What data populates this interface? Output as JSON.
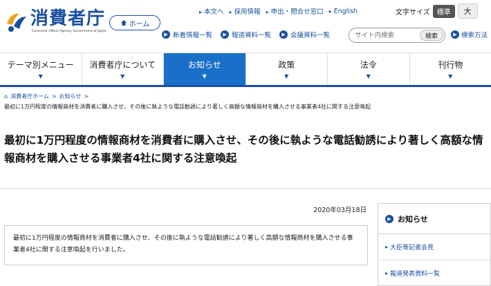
{
  "brand": {
    "name": "消費者庁",
    "subtitle": "Consumer Affairs Agency, Government of Japan",
    "colors": {
      "primary": "#1a4fa0",
      "active_nav": "#1a6fc9"
    }
  },
  "header": {
    "home_label": "ホーム",
    "top_links": [
      "本文へ",
      "採用情報",
      "申出・問合せ窓口",
      "English"
    ],
    "font_size_label": "文字サイズ",
    "font_size_standard": "標準",
    "font_size_large": "大",
    "sub_links": [
      "新着情報一覧",
      "報道資料一覧",
      "会議資料一覧"
    ],
    "search_placeholder": "サイト内検索",
    "search_button": "検索",
    "search_help": "検索方法"
  },
  "nav": {
    "items": [
      "テーマ別メニュー",
      "消費者庁について",
      "お知らせ",
      "政策",
      "法令",
      "刊行物"
    ],
    "active": "お知らせ"
  },
  "breadcrumb": {
    "items": [
      "消費者庁ホーム",
      "お知らせ"
    ],
    "separator": ">",
    "current": "最初に1万円程度の情報商材を消費者に購入させ、その後に執ような電話勧誘により著しく高額な情報商材を購入させる事業者4社に関する注意喚起"
  },
  "article": {
    "title": "最初に1万円程度の情報商材を消費者に購入させ、その後に執ような電話勧誘により著しく高額な情報商材を購入させる事業者4社に関する注意喚起",
    "date": "2020年03月18日",
    "summary": "最初に1万円程度の情報商材を消費者に購入させ、その後に執ような電話勧誘により著しく高額な情報商材を購入させる事業者4社に関する注意喚起を行いました。"
  },
  "sidebar": {
    "heading": "お知らせ",
    "items": [
      "大臣等記者会見",
      "報道発表資料一覧"
    ]
  }
}
